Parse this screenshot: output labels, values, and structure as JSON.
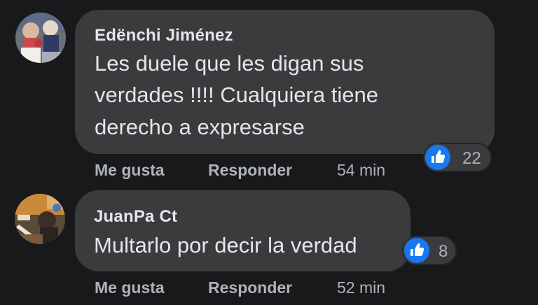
{
  "comments": [
    {
      "author": "Edënchi Jiménez",
      "lines": [
        "Les duele que les digan sus",
        "verdades !!!! Cualquiera tiene",
        "derecho a expresarse"
      ],
      "reaction_icon": "like-icon",
      "reaction_count": "22",
      "actions": {
        "like": "Me gusta",
        "reply": "Responder",
        "time": "54 min"
      }
    },
    {
      "author": "JuanPa Ct",
      "lines": [
        "Multarlo por decir la verdad"
      ],
      "reaction_icon": "like-icon",
      "reaction_count": "8",
      "actions": {
        "like": "Me gusta",
        "reply": "Responder",
        "time": "52 min"
      }
    }
  ],
  "colors": {
    "background": "#18191a",
    "bubble": "#3a3b3c",
    "text": "#e4e6eb",
    "secondary_text": "#b0b3b8",
    "like_blue": "#1877f2"
  }
}
